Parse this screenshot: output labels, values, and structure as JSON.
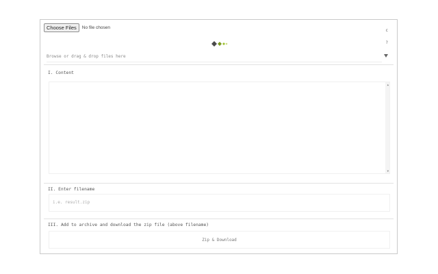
{
  "file_input": {
    "button_label": "Choose Files",
    "status": "No file chosen"
  },
  "side_icons": {
    "top": "c",
    "mid": "?",
    "chevron": "caret-down-icon"
  },
  "drop_zone": {
    "label": "Browse or drag & drop files here"
  },
  "content_section": {
    "title": "I. Content"
  },
  "filename_section": {
    "title": "II. Enter filename",
    "placeholder": "i.e. result.zip"
  },
  "download_section": {
    "title": "III. Add to archive and download the zip file (above filename)",
    "button_label": "Zip & Download"
  },
  "logo": {
    "colors": [
      "#4a4a4a",
      "#7a9a1e",
      "#9bbf2e",
      "#c4d96a"
    ]
  }
}
